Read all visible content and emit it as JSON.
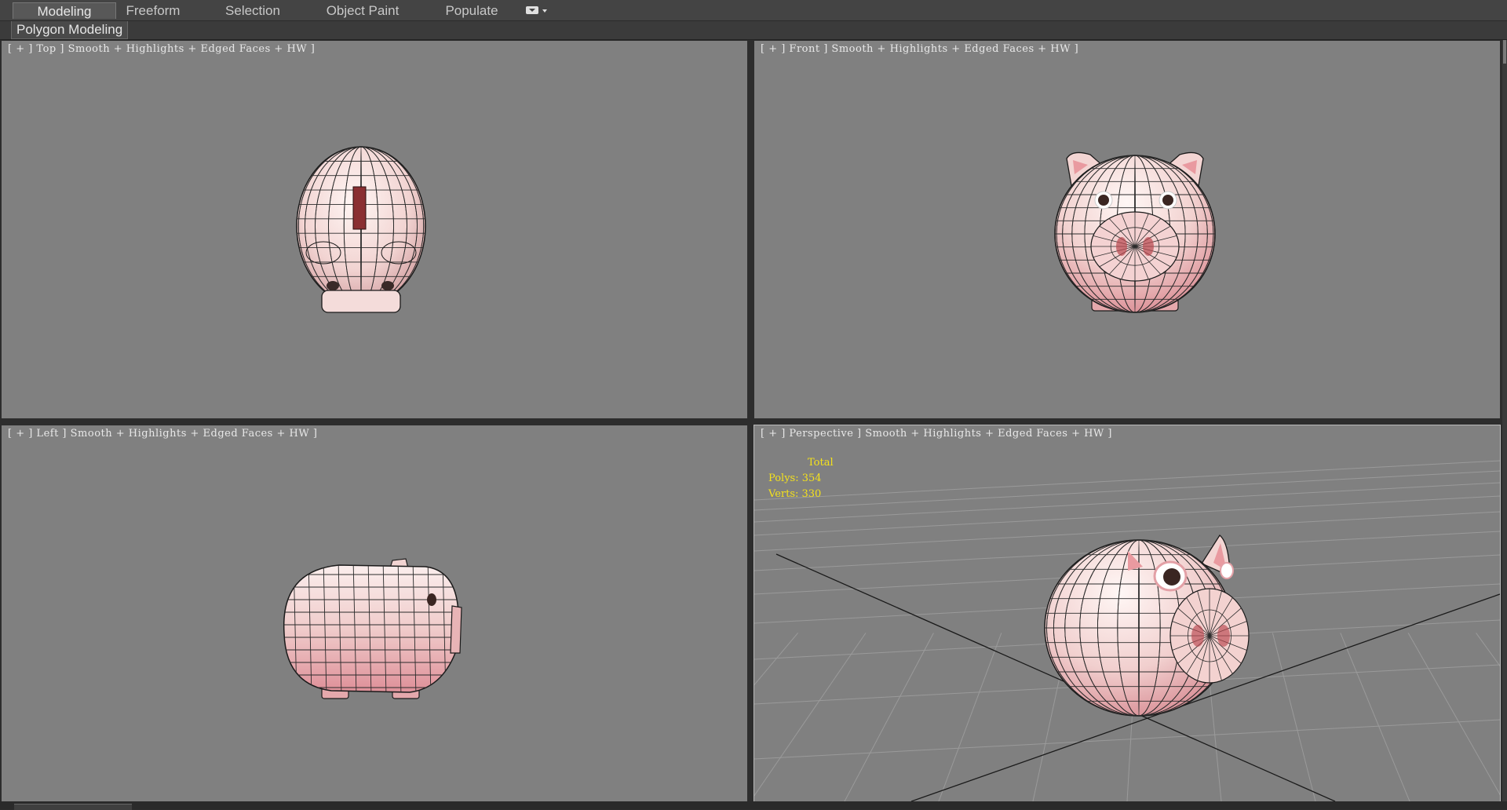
{
  "ribbon": {
    "tabs": [
      {
        "label": "Modeling",
        "active": true
      },
      {
        "label": "Freeform",
        "active": false
      },
      {
        "label": "Selection",
        "active": false
      },
      {
        "label": "Object Paint",
        "active": false
      },
      {
        "label": "Populate",
        "active": false
      }
    ],
    "panel_tab": "Polygon Modeling"
  },
  "viewports": {
    "top": {
      "label": "[ + ] Top ] Smooth + Highlights + Edged Faces + HW ]"
    },
    "front": {
      "label": "[ + ] Front ] Smooth + Highlights + Edged Faces + HW ]"
    },
    "left": {
      "label": "[ + ] Left ] Smooth + Highlights + Edged Faces + HW ]"
    },
    "perspective": {
      "label": "[ + ] Perspective ] Smooth + Highlights + Edged Faces + HW ]",
      "stats": {
        "heading": "Total",
        "polys": "Polys: 354",
        "verts": "Verts: 330"
      }
    }
  },
  "colors": {
    "viewport_bg": "#808080",
    "pig_skin": "#f2cfcf",
    "pig_shade": "#d9848c",
    "wire": "#1a1a1a",
    "stats_text": "#f4e11c"
  }
}
